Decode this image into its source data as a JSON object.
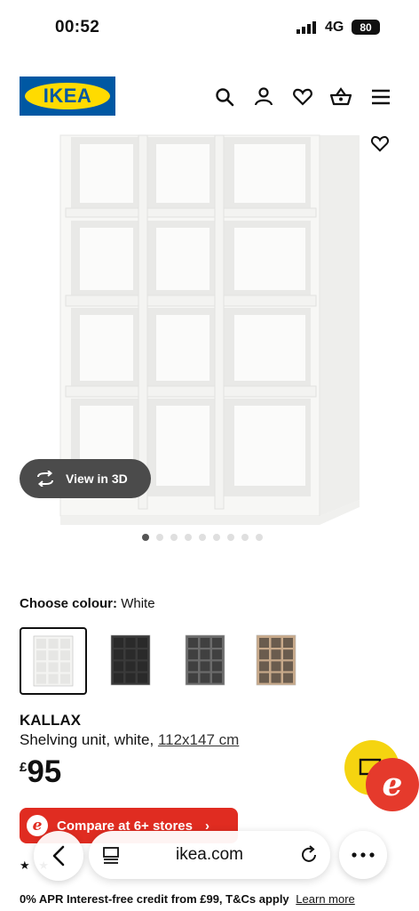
{
  "status_bar": {
    "time": "00:52",
    "network": "4G",
    "battery": "80"
  },
  "header": {
    "logo_text": "IKEA",
    "icons": [
      "search-icon",
      "user-icon",
      "heart-icon",
      "basket-icon",
      "menu-icon"
    ]
  },
  "gallery": {
    "view_3d_label": "View in 3D",
    "dots_count": 9,
    "active_dot": 1
  },
  "colour": {
    "label": "Choose colour:",
    "selected": "White",
    "swatches": [
      {
        "name": "White",
        "color": "#f4f4f2",
        "selected": true
      },
      {
        "name": "Black-brown",
        "color": "#3a3a3a",
        "selected": false
      },
      {
        "name": "Grey",
        "color": "#6b6b6b",
        "selected": false
      },
      {
        "name": "Oak",
        "color": "#c7a98a",
        "selected": false
      }
    ]
  },
  "product": {
    "name": "KALLAX",
    "description": "Shelving unit, white,",
    "size": "112x147 cm",
    "price_currency": "£",
    "price": "95"
  },
  "compare": {
    "label": "Compare at 6+ stores",
    "logo": "e"
  },
  "honey": {
    "logo": "e"
  },
  "browser": {
    "url": "ikea.com"
  },
  "finance": {
    "text": "0% APR Interest-free credit from £99, T&Cs apply",
    "link": "Learn more"
  },
  "colors": {
    "ikea_blue": "#0058a3",
    "ikea_yellow": "#ffdb00",
    "compare_red": "#e02c21"
  }
}
